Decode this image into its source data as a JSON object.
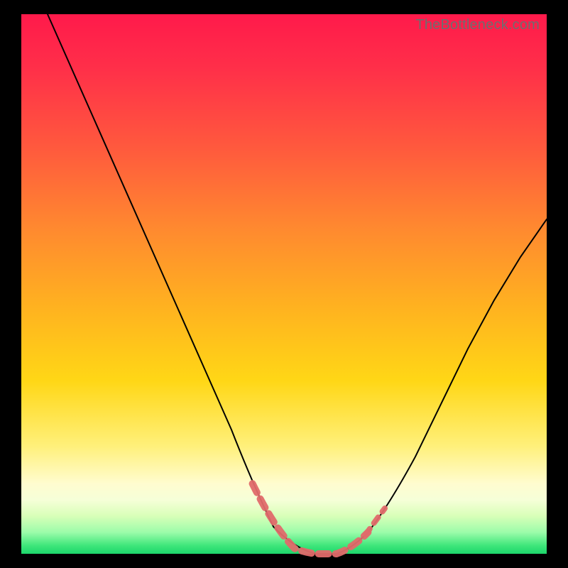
{
  "watermark": "TheBottleneck.com",
  "colors": {
    "frame_bg": "#000000",
    "gradient_top": "#ff1a4b",
    "gradient_mid": "#ffd716",
    "gradient_bottom": "#1cd66b",
    "curve_stroke": "#000000",
    "bead_stroke": "#e06a6a"
  },
  "chart_data": {
    "type": "line",
    "title": "",
    "xlabel": "",
    "ylabel": "",
    "xlim": [
      0,
      100
    ],
    "ylim": [
      0,
      100
    ],
    "grid": false,
    "series": [
      {
        "name": "bottleneck-curve",
        "x": [
          5,
          10,
          15,
          20,
          25,
          30,
          35,
          40,
          44,
          48,
          52,
          56,
          60,
          63,
          66,
          70,
          75,
          80,
          85,
          90,
          95,
          100
        ],
        "y": [
          100,
          89,
          78,
          67,
          56,
          45,
          34,
          23,
          13,
          5,
          1,
          0,
          0,
          1,
          4,
          9,
          18,
          28,
          38,
          47,
          55,
          62
        ]
      }
    ],
    "annotations": [
      {
        "name": "sweet-spot-beads",
        "x_range": [
          44,
          66
        ],
        "y_approx": 0
      }
    ]
  }
}
